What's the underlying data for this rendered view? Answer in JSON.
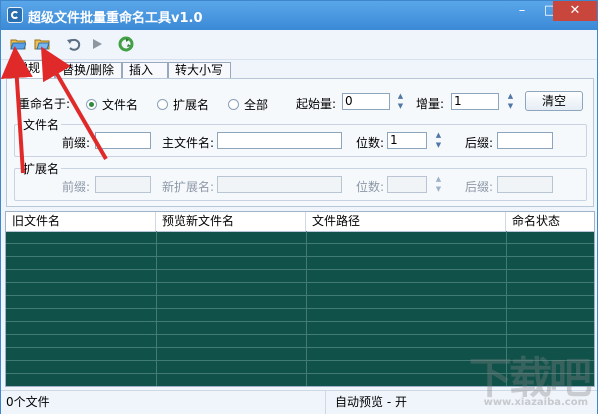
{
  "app": {
    "title": "超级文件批量重命名工具v1.0"
  },
  "window_controls": {
    "minimize": "–",
    "maximize": "□",
    "close": "✕"
  },
  "toolbar": {
    "icons": [
      "open-folder-icon",
      "open-files-icon",
      "undo-icon",
      "play-icon",
      "recycle-icon"
    ]
  },
  "tabs": [
    {
      "label": "常规",
      "active": true
    },
    {
      "label": "替换/删除"
    },
    {
      "label": "插入"
    },
    {
      "label": "转大小写"
    }
  ],
  "rename": {
    "label": "重命名于:",
    "options": [
      "文件名",
      "扩展名",
      "全部"
    ],
    "selected": "文件名",
    "start_label": "起始量:",
    "start_value": "0",
    "inc_label": "增量:",
    "inc_value": "1",
    "clear_label": "清空"
  },
  "filename_group": {
    "title": "文件名",
    "prefix_label": "前缀:",
    "main_label": "主文件名:",
    "digits_label": "位数:",
    "digits_value": "1",
    "suffix_label": "后缀:"
  },
  "ext_group": {
    "title": "扩展名",
    "prefix_label": "前缀:",
    "new_ext_label": "新扩展名:",
    "digits_label": "位数:",
    "suffix_label": "后缀:"
  },
  "table": {
    "columns": [
      "旧文件名",
      "预览新文件名",
      "文件路径",
      "命名状态"
    ],
    "rows": []
  },
  "status": {
    "file_count": "0个文件",
    "auto_preview": "自动预览 - 开"
  },
  "watermark": {
    "text": "下载吧",
    "domain": "www.xiazaiba.com"
  },
  "colors": {
    "title_bar": "#3b8ad6",
    "list_bg": "#10524a",
    "arrow": "#e02a2a"
  }
}
